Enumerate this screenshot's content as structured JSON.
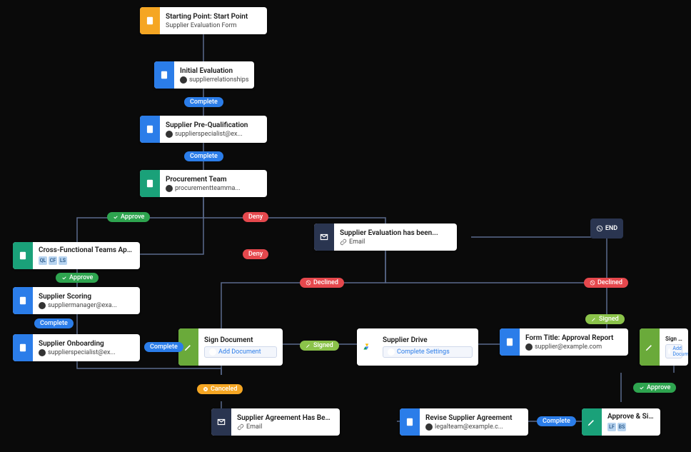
{
  "nodes": {
    "start": {
      "title": "Starting Point: Start Point",
      "sub": "Supplier Evaluation Form"
    },
    "initial": {
      "title": "Initial Evaluation",
      "sub": "supplierrelationshipsp..."
    },
    "prequal": {
      "title": "Supplier Pre-Qualification",
      "sub": "supplierspecialist@ex..."
    },
    "procure": {
      "title": "Procurement Team",
      "sub": "procurementteamma..."
    },
    "crossfn": {
      "title": "Cross-Functional Teams App...",
      "avatars": [
        "QL",
        "CF",
        "LS"
      ]
    },
    "scoring": {
      "title": "Supplier Scoring",
      "sub": "suppliermanager@exa..."
    },
    "onboard": {
      "title": "Supplier Onboarding",
      "sub": "supplierspecialist@ex..."
    },
    "supeval": {
      "title": "Supplier Evaluation has been...",
      "sub": "Email"
    },
    "sign1": {
      "title": "Sign Document",
      "btn": "Add Document"
    },
    "drive": {
      "title": "Supplier Drive",
      "btn": "Complete Settings"
    },
    "formtitle": {
      "title": "Form Title:  Approval Report",
      "sub": "supplier@example.com"
    },
    "sign2": {
      "title": "Sign Document",
      "btn": "Add Document"
    },
    "agreement": {
      "title": "Supplier Agreement Has Bee...",
      "sub": "Email"
    },
    "revise": {
      "title": "Revise Supplier Agreement",
      "sub": "legalteam@example.c..."
    },
    "appsign": {
      "title": "Approve & Sign",
      "avatars": [
        "LF",
        "BS"
      ]
    },
    "end": {
      "label": "END"
    }
  },
  "pills": {
    "complete": "Complete",
    "approve": "Approve",
    "deny": "Deny",
    "declined": "Declined",
    "signed": "Signed",
    "canceled": "Canceled"
  }
}
